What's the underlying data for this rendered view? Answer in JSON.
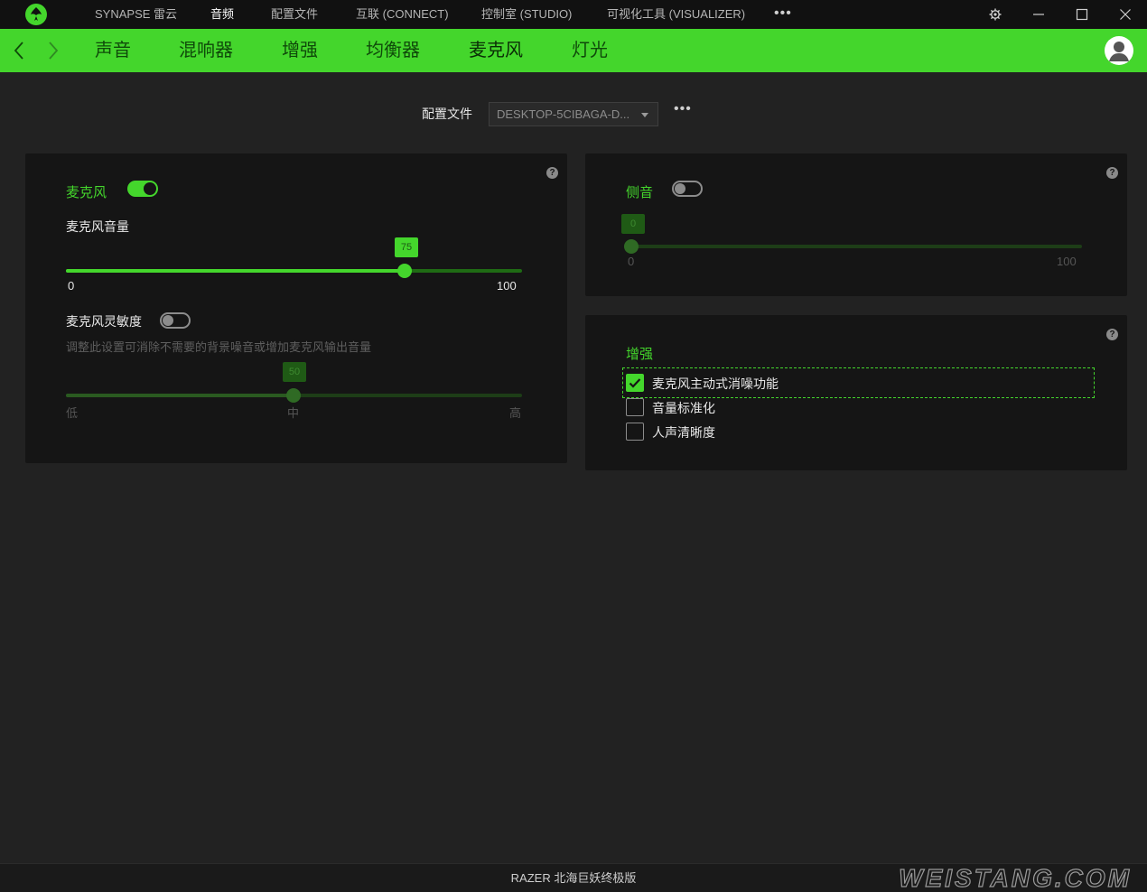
{
  "top_nav": {
    "items": [
      {
        "label": "SYNAPSE 雷云"
      },
      {
        "label": "音频"
      },
      {
        "label": "配置文件"
      },
      {
        "label": "互联 (CONNECT)"
      },
      {
        "label": "控制室 (STUDIO)"
      },
      {
        "label": "可视化工具 (VISUALIZER)"
      }
    ],
    "more": "•••",
    "active_index": 1
  },
  "sub_nav": {
    "tabs": [
      {
        "label": "声音"
      },
      {
        "label": "混响器"
      },
      {
        "label": "增强"
      },
      {
        "label": "均衡器"
      },
      {
        "label": "麦克风"
      },
      {
        "label": "灯光"
      }
    ],
    "active_index": 4
  },
  "profile": {
    "label": "配置文件",
    "selected": "DESKTOP-5CIBAGA-D...",
    "more": "•••"
  },
  "mic_panel": {
    "title": "麦克风",
    "enabled": true,
    "volume_label": "麦克风音量",
    "volume_value": "75",
    "volume_min": "0",
    "volume_max": "100",
    "sensitivity_label": "麦克风灵敏度",
    "sensitivity_enabled": false,
    "sensitivity_desc": "调整此设置可消除不需要的背景噪音或增加麦克风输出音量",
    "sensitivity_value": "50",
    "sensitivity_low": "低",
    "sensitivity_mid": "中",
    "sensitivity_high": "高",
    "help": "?"
  },
  "sidetone_panel": {
    "title": "侧音",
    "enabled": false,
    "value": "0",
    "min": "0",
    "max": "100",
    "help": "?"
  },
  "enhance_panel": {
    "title": "增强",
    "help": "?",
    "options": [
      {
        "label": "麦克风主动式消噪功能",
        "checked": true
      },
      {
        "label": "音量标准化",
        "checked": false
      },
      {
        "label": "人声清晰度",
        "checked": false
      }
    ]
  },
  "footer": {
    "text": "RAZER 北海巨妖终极版"
  },
  "watermark": "WEISTANG.COM",
  "colors": {
    "accent": "#44d62c",
    "background": "#222222",
    "panel": "#151515",
    "titlebar": "#111111"
  },
  "icons": [
    "razer-logo-icon",
    "settings-gear-icon",
    "minimize-icon",
    "maximize-icon",
    "close-icon",
    "back-arrow-icon",
    "forward-arrow-icon",
    "user-avatar-icon",
    "help-icon",
    "dropdown-caret-icon",
    "checkmark-icon"
  ]
}
